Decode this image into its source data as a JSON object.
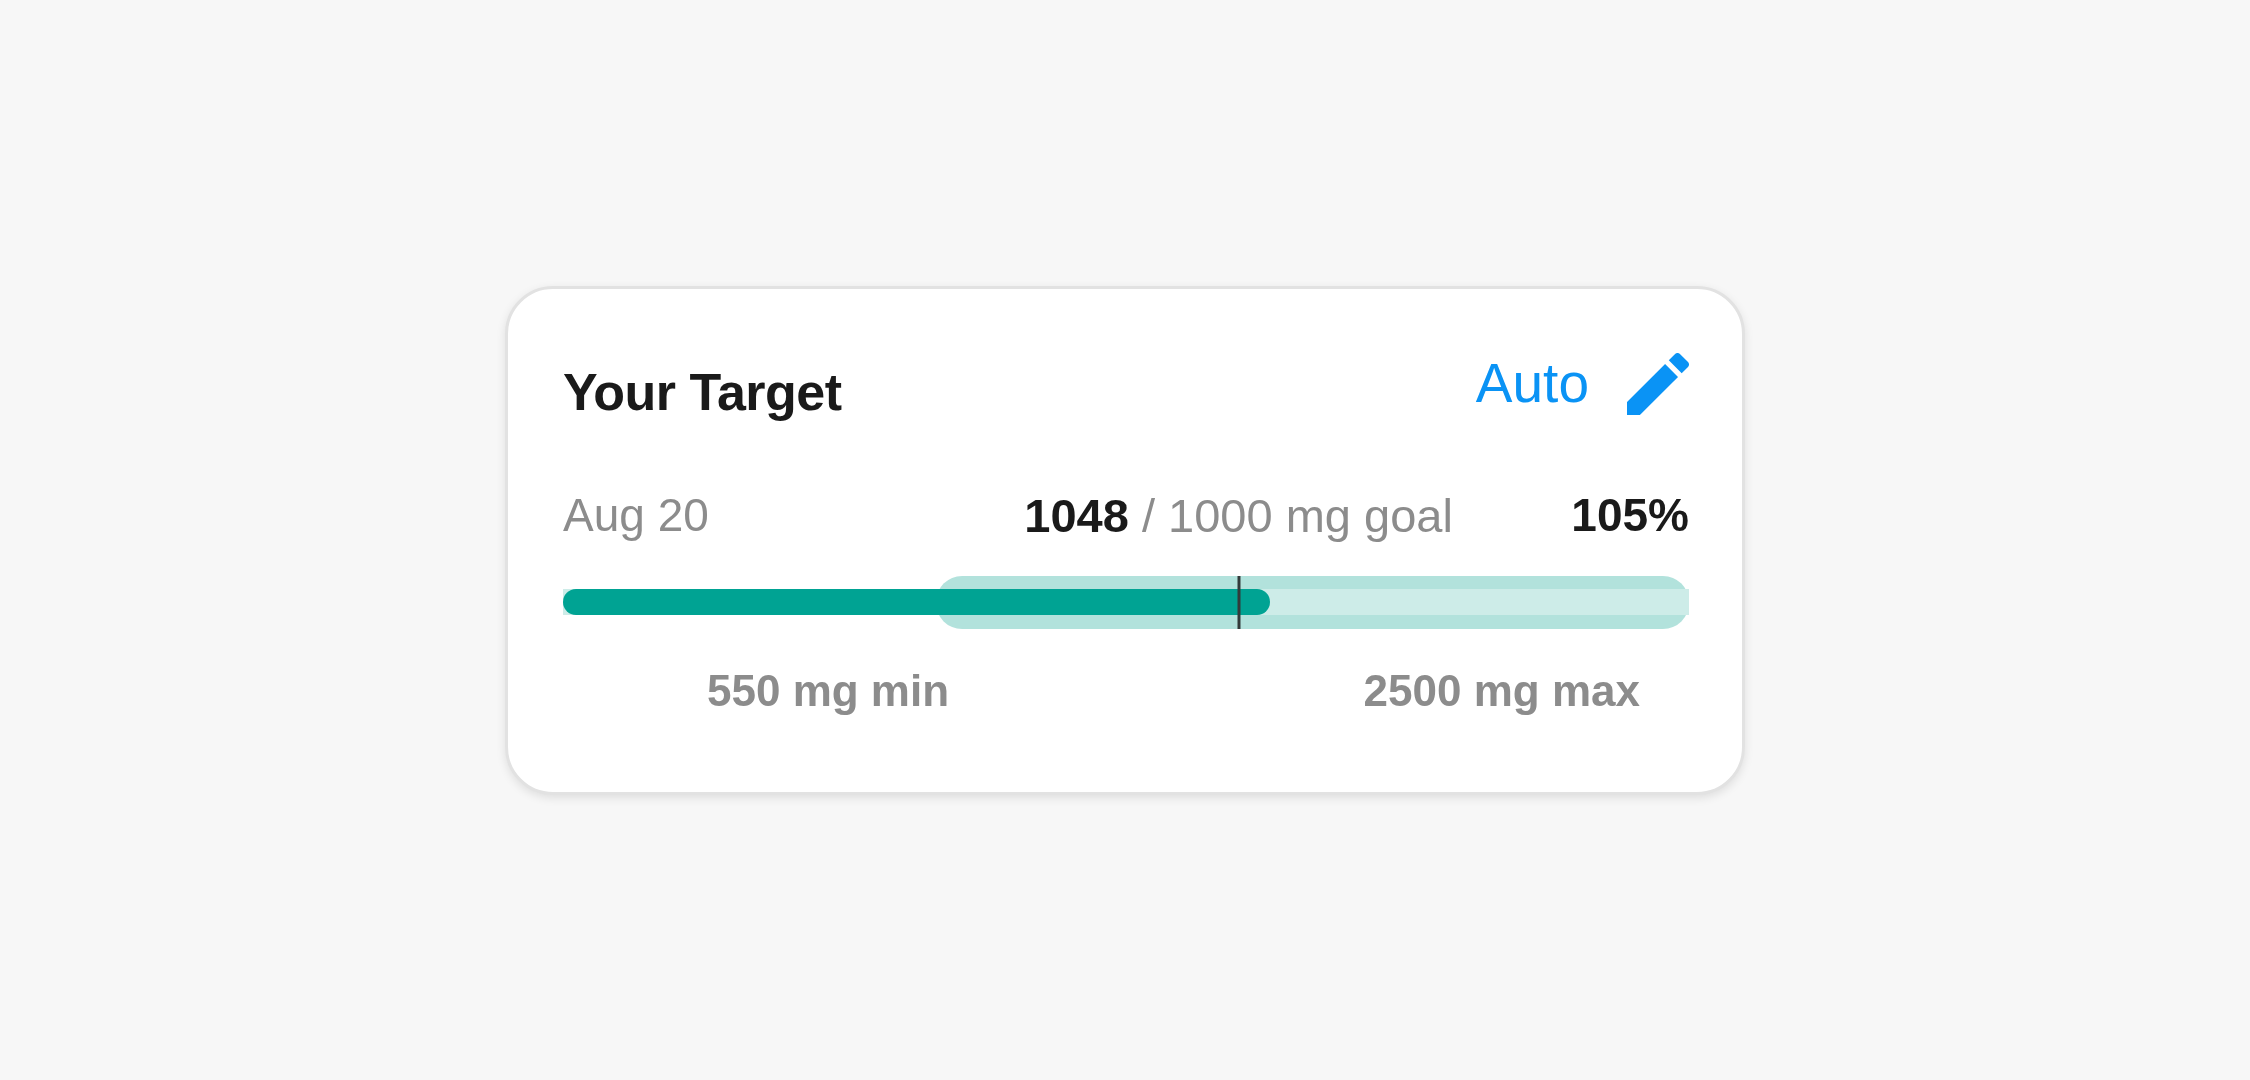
{
  "card": {
    "title": "Your Target",
    "mode": {
      "label": "Auto"
    }
  },
  "summary": {
    "date": "Aug 20",
    "goal_text": "**1048** / 1000 mg goal",
    "percent": "105%"
  },
  "bar": {
    "level": 0.628,
    "range_band": {
      "level": 0.669
    },
    "goal_marker": {
      "level": 0.6
    }
  },
  "limits": {
    "min": "550 mg min",
    "max": "2500 mg max"
  }
}
